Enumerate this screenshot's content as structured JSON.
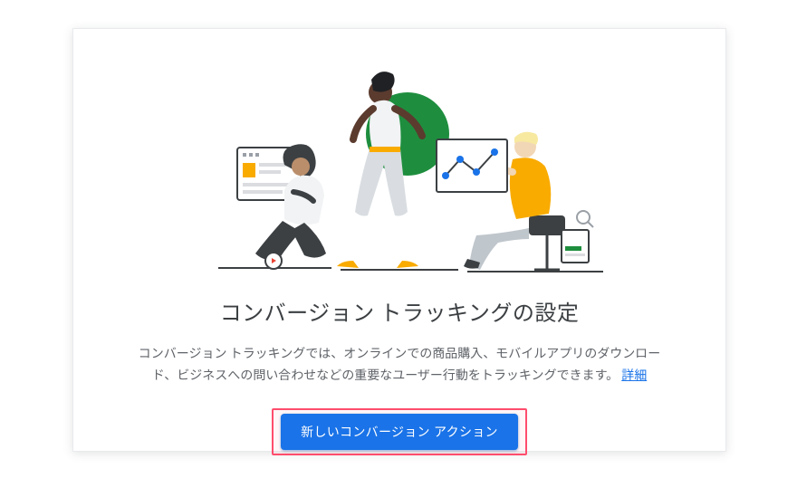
{
  "title": "コンバージョン トラッキングの設定",
  "description": "コンバージョン トラッキングでは、オンラインでの商品購入、モバイルアプリのダウンロード、ビジネスへの問い合わせなどの重要なユーザー行動をトラッキングできます。",
  "learn_more_label": "詳細",
  "primary_button_label": "新しいコンバージョン アクション"
}
